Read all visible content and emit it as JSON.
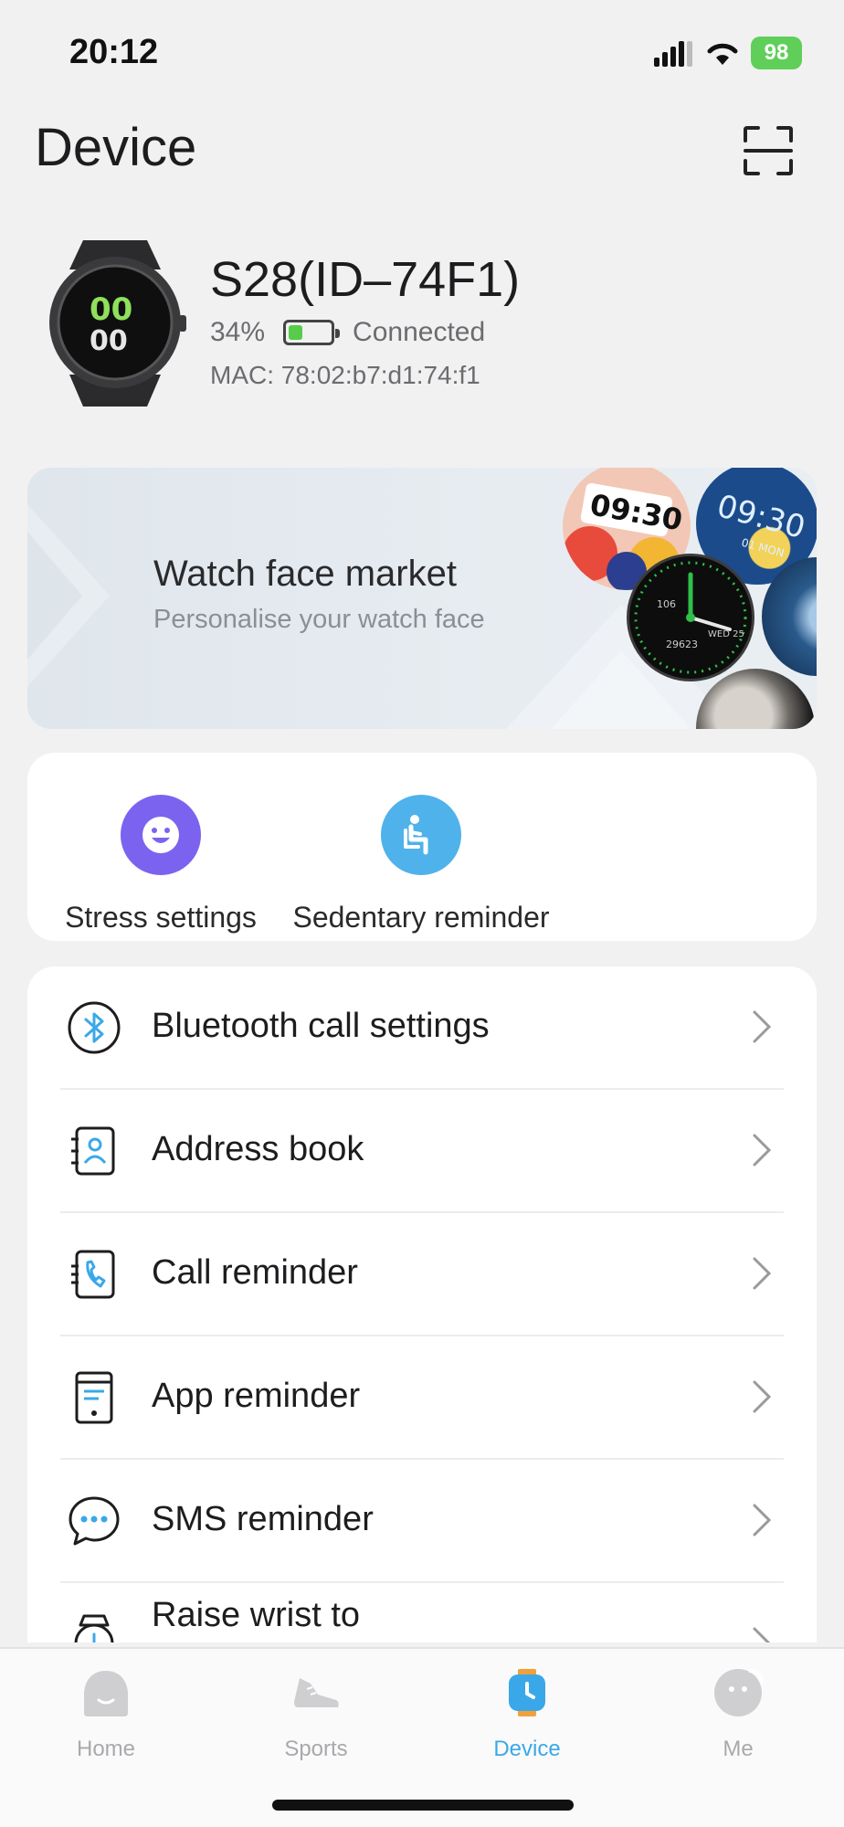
{
  "status_bar": {
    "time": "20:12",
    "battery": "98",
    "icons": [
      "cellular-signal-icon",
      "wifi-icon",
      "battery-charging-icon"
    ]
  },
  "header": {
    "title": "Device",
    "scan_icon": "scan-icon"
  },
  "device": {
    "name": "S28(ID–74F1)",
    "battery_percent": "34%",
    "battery_level": 0.34,
    "connection_status": "Connected",
    "mac": "MAC: 78:02:b7:d1:74:f1"
  },
  "banner": {
    "title": "Watch face market",
    "subtitle": "Personalise your watch face"
  },
  "quick_settings": [
    {
      "label": "Stress settings",
      "icon": "smiley-face-icon",
      "color": "#7b63f0"
    },
    {
      "label": "Sedentary reminder",
      "icon": "seated-person-icon",
      "color": "#4fb2ea"
    }
  ],
  "settings_list": [
    {
      "label": "Bluetooth call settings",
      "icon": "bluetooth-icon"
    },
    {
      "label": "Address book",
      "icon": "contacts-book-icon"
    },
    {
      "label": "Call reminder",
      "icon": "phone-call-icon"
    },
    {
      "label": "App reminder",
      "icon": "phone-app-icon"
    },
    {
      "label": "SMS reminder",
      "icon": "chat-bubble-icon"
    },
    {
      "label": "Raise wrist to",
      "icon": "watch-wrist-icon"
    }
  ],
  "tabs": [
    {
      "label": "Home",
      "icon": "home-icon",
      "active": false
    },
    {
      "label": "Sports",
      "icon": "shoe-icon",
      "active": false
    },
    {
      "label": "Device",
      "icon": "watch-icon",
      "active": true
    },
    {
      "label": "Me",
      "icon": "face-icon",
      "active": false
    }
  ],
  "colors": {
    "accent": "#3aa8e8",
    "stress": "#7b63f0",
    "sedentary": "#4fb2ea",
    "battery_green": "#5fcf59"
  }
}
